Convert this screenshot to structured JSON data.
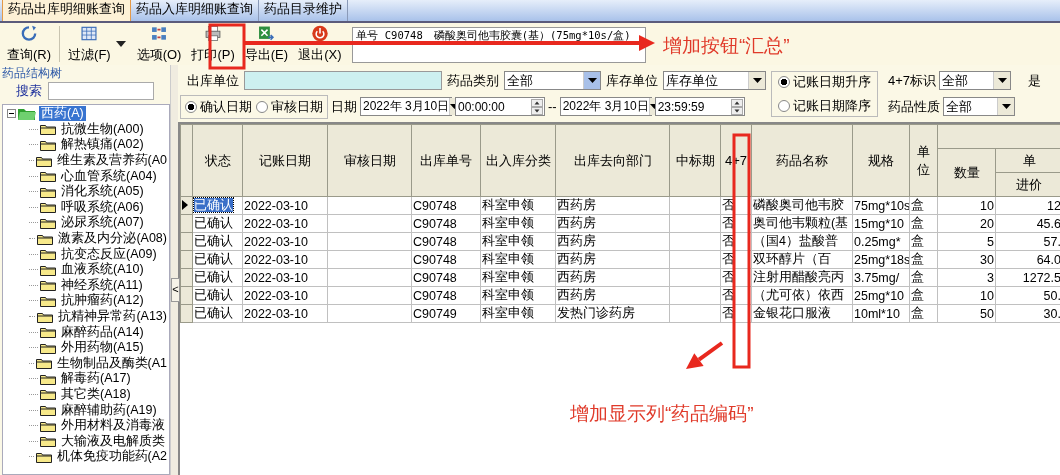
{
  "tabs": [
    {
      "label": "药品出库明细账查询",
      "selected": true
    },
    {
      "label": "药品入库明细账查询",
      "selected": false
    },
    {
      "label": "药品目录维护",
      "selected": false
    }
  ],
  "toolbar": {
    "buttons": [
      {
        "label": "查询(R)",
        "divider_after": true,
        "has_menu": false
      },
      {
        "label": "过滤(F)",
        "divider_after": false,
        "has_menu": true
      },
      {
        "label": "选项(O)",
        "divider_after": false,
        "has_menu": false
      },
      {
        "label": "打印(P)",
        "divider_after": false,
        "has_menu": false
      },
      {
        "label": "导出(E)",
        "divider_after": false,
        "has_menu": false
      },
      {
        "label": "退出(X)",
        "divider_after": false,
        "has_menu": false
      }
    ],
    "info_lines": [
      "单号 C90748　磷酸奥司他韦胶囊(基）(75mg*10s/盒)"
    ]
  },
  "sidebar": {
    "title": "药品结构树",
    "search_label": "搜索",
    "tree": [
      {
        "label": "西药(A)",
        "selected": true,
        "expanded": true,
        "children": [
          {
            "label": "抗微生物(A00)",
            "selected": false
          },
          {
            "label": "解热镇痛(A02)",
            "selected": false
          },
          {
            "label": "维生素及营养药(A0",
            "selected": false
          },
          {
            "label": "心血管系统(A04)",
            "selected": false
          },
          {
            "label": "消化系统(A05)",
            "selected": false
          },
          {
            "label": "呼吸系统(A06)",
            "selected": false
          },
          {
            "label": "泌尿系统(A07)",
            "selected": false
          },
          {
            "label": "激素及内分泌(A08)",
            "selected": false
          },
          {
            "label": "抗变态反应(A09)",
            "selected": false
          },
          {
            "label": "血液系统(A10)",
            "selected": false
          },
          {
            "label": "神经系统(A11)",
            "selected": false
          },
          {
            "label": "抗肿瘤药(A12)",
            "selected": false
          },
          {
            "label": "抗精神异常药(A13)",
            "selected": false
          },
          {
            "label": "麻醉药品(A14)",
            "selected": false
          },
          {
            "label": "外用药物(A15)",
            "selected": false
          },
          {
            "label": "生物制品及酶类(A1",
            "selected": false
          },
          {
            "label": "解毒药(A17)",
            "selected": false
          },
          {
            "label": "其它类(A18)",
            "selected": false
          },
          {
            "label": "麻醉辅助药(A19)",
            "selected": false
          },
          {
            "label": "外用材料及消毒液",
            "selected": false
          },
          {
            "label": "大输液及电解质类",
            "selected": false
          },
          {
            "label": "机体免疫功能药(A2",
            "selected": false
          }
        ]
      }
    ]
  },
  "splitter": {
    "button": "<"
  },
  "filters": {
    "row1": [
      {
        "kind": "label",
        "text": "出库单位"
      },
      {
        "kind": "field"
      },
      {
        "kind": "label",
        "text": "药品类别"
      },
      {
        "kind": "dropdown",
        "value": "全部",
        "focused": true
      },
      {
        "kind": "label",
        "text": "库存单位"
      },
      {
        "kind": "dropdown",
        "value": "库存单位",
        "focused": false
      }
    ],
    "row2": [
      {
        "kind": "radio-group",
        "options": [
          {
            "label": "确认日期",
            "selected": true
          },
          {
            "label": "审核日期",
            "selected": false
          }
        ]
      },
      {
        "kind": "label",
        "text": "日期"
      },
      {
        "kind": "date",
        "value": "2022年 3月10日"
      },
      {
        "kind": "time",
        "value": "00:00:00"
      },
      {
        "kind": "label",
        "text": "--"
      },
      {
        "kind": "date",
        "value": "2022年 3月10日"
      },
      {
        "kind": "time",
        "value": "23:59:59"
      }
    ],
    "sort_options": [
      {
        "label": "记账日期升序",
        "selected": true
      },
      {
        "label": "记账日期降序",
        "selected": false
      }
    ],
    "right_rows": [
      [
        {
          "kind": "label",
          "text": "4+7标识"
        },
        {
          "kind": "dropdown",
          "value": "全部",
          "focused": false
        },
        {
          "kind": "label",
          "text": "是"
        }
      ],
      [
        {
          "kind": "label",
          "text": "药品性质"
        },
        {
          "kind": "dropdown",
          "value": "全部",
          "focused": false
        }
      ]
    ]
  },
  "grid": {
    "columns": [
      "状态",
      "记账日期",
      "审核日期",
      "出库单号",
      "出入库分类",
      "出库去向部门",
      "中标期",
      "4+7",
      "药品名称",
      "规格",
      "单位"
    ],
    "group_columns": [
      {
        "label": "数量"
      },
      {
        "label": "单",
        "sub_label": "进价"
      }
    ],
    "rows": [
      {
        "selected": true,
        "cells": [
          "已确认",
          "2022-03-10",
          null,
          "C90748",
          "科室申领",
          "西药房",
          null,
          "否",
          "磷酸奥司他韦胶",
          "75mg*10s",
          "盒",
          "10",
          "12"
        ]
      },
      {
        "selected": false,
        "cells": [
          "已确认",
          "2022-03-10",
          null,
          "C90748",
          "科室申领",
          "西药房",
          null,
          "否",
          "奥司他韦颗粒(基",
          "15mg*10",
          "盒",
          "20",
          "45.6"
        ]
      },
      {
        "selected": false,
        "cells": [
          "已确认",
          "2022-03-10",
          null,
          "C90748",
          "科室申领",
          "西药房",
          null,
          "否",
          "（国4）盐酸普",
          "0.25mg*",
          "盒",
          "5",
          "57."
        ]
      },
      {
        "selected": false,
        "cells": [
          "已确认",
          "2022-03-10",
          null,
          "C90748",
          "科室申领",
          "西药房",
          null,
          "否",
          "双环醇片（百",
          "25mg*18s",
          "盒",
          "30",
          "64.0"
        ]
      },
      {
        "selected": false,
        "cells": [
          "已确认",
          "2022-03-10",
          null,
          "C90748",
          "科室申领",
          "西药房",
          null,
          "否",
          "注射用醋酸亮丙",
          "3.75mg/",
          "盒",
          "3",
          "1272.5"
        ]
      },
      {
        "selected": false,
        "cells": [
          "已确认",
          "2022-03-10",
          null,
          "C90748",
          "科室申领",
          "西药房",
          null,
          "否",
          "（尤可依）依西",
          "25mg*10",
          "盒",
          "10",
          "50."
        ]
      },
      {
        "selected": false,
        "cells": [
          "已确认",
          "2022-03-10",
          null,
          "C90749",
          "科室申领",
          "发热门诊药房",
          null,
          "否",
          "金银花口服液",
          "10ml*10",
          "盒",
          "50",
          "30."
        ]
      }
    ]
  },
  "annotations": [
    {
      "kind": "box"
    },
    {
      "kind": "arrow"
    },
    {
      "kind": "note",
      "text": "增加按钮“汇总”"
    },
    {
      "kind": "box"
    },
    {
      "kind": "arrow"
    },
    {
      "kind": "note",
      "text": "增加显示列“药品编码”"
    }
  ]
}
